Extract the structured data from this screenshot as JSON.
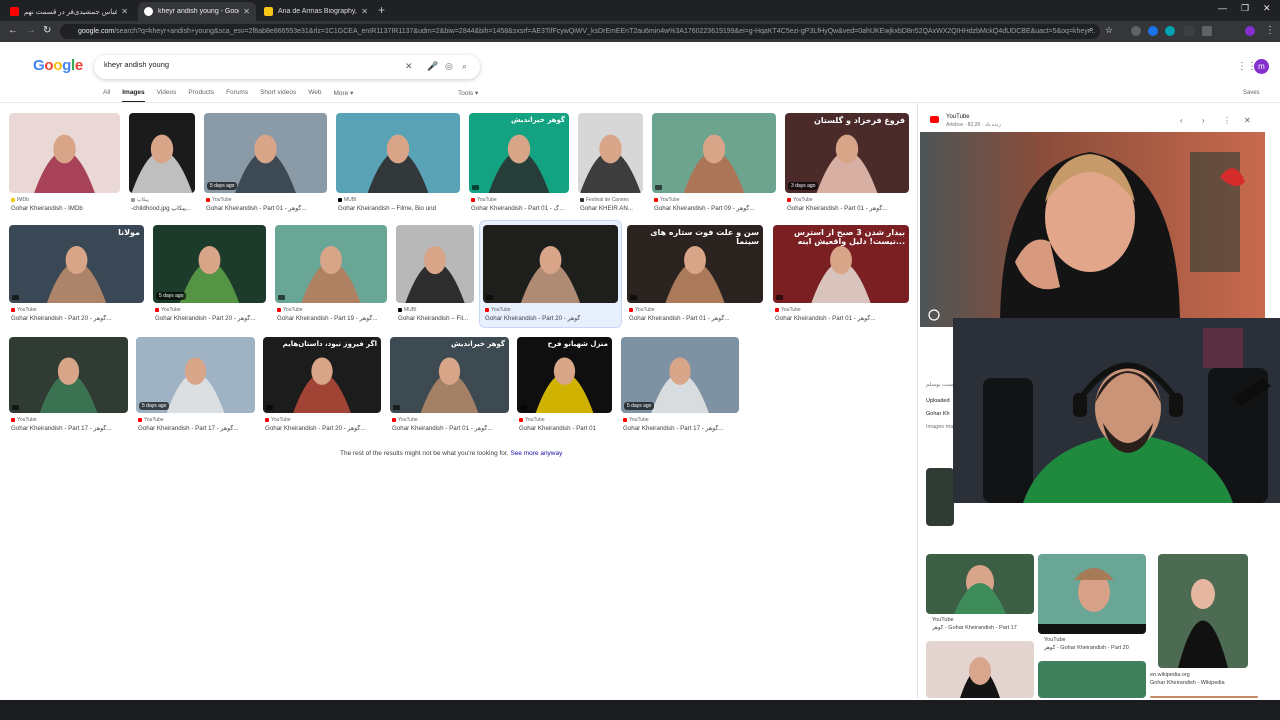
{
  "browser": {
    "tabs": [
      {
        "title": "عباس جمشیدی‌فر در قسمت نهم",
        "active": false,
        "favicon": "youtube-icon"
      },
      {
        "title": "kheyr andish young - Google S",
        "active": true,
        "favicon": "google-icon"
      },
      {
        "title": "Ana de Armas Biography, Acto",
        "active": false,
        "favicon": "imdb-icon"
      }
    ],
    "url_host": "google.com",
    "url_rest": "/search?q=kheyr+andish+young&sca_esv=2f8ab8e866553e31&rlz=1C1GCEA_enIR1137IR1137&udm=2&biw=2844&bih=1458&sxsrf=AE3TifFcywQiWV_ksDrEmEEnT2au6min4w%3A1760223619199&ei=g-HqaKT4C5ezi-gP3LfHyQw&ved=0ahUKEwjkxbD8n52QAxWX2QIHHdzbMckQ4dUDCBE&uact=5&oq=kheyr..."
  },
  "search": {
    "logo": "Google",
    "query": "kheyr andish young",
    "tabs": [
      "All",
      "Images",
      "Videos",
      "Products",
      "Forums",
      "Short videos",
      "Web",
      "More ▾"
    ],
    "active_tab": "Images",
    "tools": "Tools ▾",
    "saves": "Saves",
    "avatar": "m"
  },
  "results": [
    {
      "source": "IMDb",
      "caption": "Gohar Kheirandish - IMDb",
      "src_color": "#f5c518",
      "bg": "#e9d8d6",
      "accent": "#9b2842"
    },
    {
      "source": "پیکاپ",
      "caption": "-childhood.jpg پیکاپ...",
      "src_color": "#999999",
      "bg": "#1b1b1b",
      "accent": "#dcdcdc"
    },
    {
      "source": "YouTube",
      "caption": "Gohar Kheirandish - Part 01 - گوهر...",
      "src_color": "#ff0000",
      "bg": "#8a9aa6",
      "accent": "#2f3b44",
      "badge": "5 days ago"
    },
    {
      "source": "MUBI",
      "caption": "Gohar Kheirandish – Filme, Bio und",
      "src_color": "#000000",
      "bg": "#5aa3b7",
      "accent": "#2b2625"
    },
    {
      "source": "YouTube",
      "caption": "Gohar Kheirandish - Part 01 - گ...",
      "src_color": "#ff0000",
      "bg": "#13a383",
      "accent": "#2b2b2b",
      "overlay": "گوهر خیراندیش"
    },
    {
      "source": "Festival de Cannes",
      "caption": "Gohar KHEIR AN...",
      "src_color": "#333333",
      "bg": "#d7d7d7",
      "accent": "#222222"
    },
    {
      "source": "YouTube",
      "caption": "Gohar Kheirandish - Part 09 - گوهر...",
      "src_color": "#ff0000",
      "bg": "#6ca48f",
      "accent": "#b96d4d"
    },
    {
      "source": "YouTube",
      "caption": "Gohar Kheirandish - Part 01 - گوهر...",
      "src_color": "#ff0000",
      "bg": "#4b2a2a",
      "accent": "#f0c7b8",
      "badge": "3 days ago",
      "overlay": "فروغ فرخزاد و گلستان"
    },
    {
      "source": "YouTube",
      "caption": "Gohar Kheirandish - Part 20 - گوهر...",
      "src_color": "#ff0000",
      "bg": "#3a4754",
      "accent": "#c08f6d",
      "overlay": "مولانا"
    },
    {
      "source": "YouTube",
      "caption": "Gohar Kheirandish - Part 20 - گوهر...",
      "src_color": "#ff0000",
      "bg": "#1d3b2a",
      "accent": "#5fa34a",
      "badge": "5 days ago"
    },
    {
      "source": "YouTube",
      "caption": "Gohar Kheirandish - Part 19 - گوهر...",
      "src_color": "#ff0000",
      "bg": "#6aa695",
      "accent": "#b97a58"
    },
    {
      "source": "MUBI",
      "caption": "Gohar Kheirandish – Fil...",
      "src_color": "#000000",
      "bg": "#b8b8b8",
      "accent": "#141414"
    },
    {
      "source": "YouTube",
      "caption": "Gohar Kheirandish - Part 20 - گوهر",
      "src_color": "#ff0000",
      "bg": "#1e1f1d",
      "accent": "#c99f83"
    },
    {
      "source": "YouTube",
      "caption": "Gohar Kheirandish - Part 01 - گوهر...",
      "src_color": "#ff0000",
      "bg": "#2a2320",
      "accent": "#c28a66",
      "overlay": "سن و علت فوت ستاره های سینما"
    },
    {
      "source": "YouTube",
      "caption": "Gohar Kheirandish - Part 01 - گوهر...",
      "src_color": "#ff0000",
      "bg": "#7a1f22",
      "accent": "#e9e1d8",
      "overlay": "بیدار شدن 3 صبح از استرس نیست! دلیل واقعیش اینه..."
    },
    {
      "source": "YouTube",
      "caption": "Gohar Kheirandish - Part 17 - گوهر...",
      "src_color": "#ff0000",
      "bg": "#2f3b33",
      "accent": "#3d7d57"
    },
    {
      "source": "YouTube",
      "caption": "Gohar Kheirandish - Part 17 - گوهر...",
      "src_color": "#ff0000",
      "bg": "#9fb3c4",
      "accent": "#e6e6e6",
      "badge": "5 days ago"
    },
    {
      "source": "YouTube",
      "caption": "Gohar Kheirandish - Part 20 - گوهر...",
      "src_color": "#ff0000",
      "bg": "#1c1c1c",
      "accent": "#b94a3a",
      "overlay": "اگر فیروز نبود، داستان‌هایم"
    },
    {
      "source": "YouTube",
      "caption": "Gohar Kheirandish - Part 01 - گوهر...",
      "src_color": "#ff0000",
      "bg": "#3d4a52",
      "accent": "#b68a6a",
      "overlay": "گوهر خیراندیش"
    },
    {
      "source": "YouTube",
      "caption": "Gohar Kheirandish - Part 01",
      "src_color": "#ff0000",
      "bg": "#0f0f0f",
      "accent": "#f2d000",
      "overlay": "منزل شهبانو فرح"
    },
    {
      "source": "YouTube",
      "caption": "Gohar Kheirandish - Part 17 - گوهر...",
      "src_color": "#ff0000",
      "bg": "#7f92a3",
      "accent": "#e9e9e9",
      "badge": "5 days ago"
    }
  ],
  "rest_notice": {
    "text": "The rest of the results might not be what you're looking for.",
    "link": "See more anyway"
  },
  "panel": {
    "site": "YouTube",
    "subtitle": "Artebox · 82.2K · زنده یاد",
    "lines": [
      "سبت یوسلم",
      "Uploaded",
      "Gohar Kh",
      "Images ma"
    ],
    "thumb_captions": [
      "YouTube",
      "گوهر - Gohar Kheirandish - Part 17",
      "YouTube",
      "گوهر - Gohar Kheirandish - Part 20",
      "en.wikipedia.org",
      "Gohar Kheirandish - Wikipedia"
    ]
  }
}
